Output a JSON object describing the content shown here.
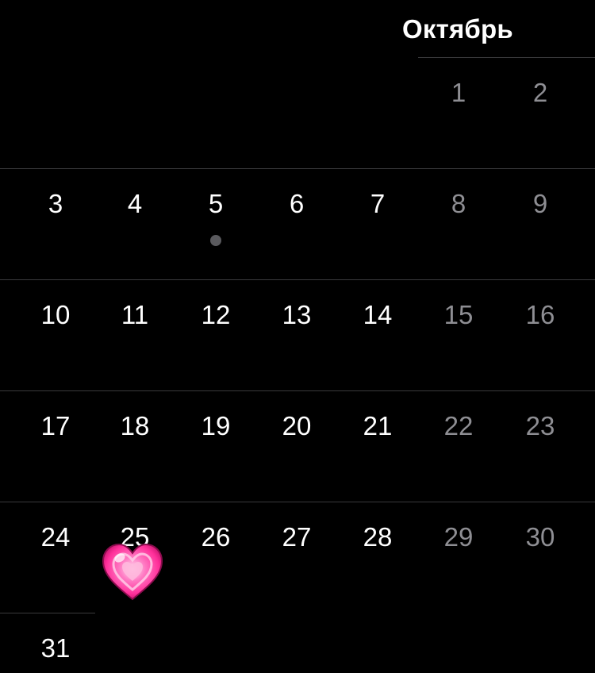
{
  "calendar": {
    "month_label": "Октябрь",
    "weeks": [
      [
        null,
        null,
        null,
        null,
        null,
        {
          "day": "1",
          "weekend": true
        },
        {
          "day": "2",
          "weekend": true
        }
      ],
      [
        {
          "day": "3"
        },
        {
          "day": "4"
        },
        {
          "day": "5",
          "has_event": true
        },
        {
          "day": "6"
        },
        {
          "day": "7"
        },
        {
          "day": "8",
          "weekend": true
        },
        {
          "day": "9",
          "weekend": true
        }
      ],
      [
        {
          "day": "10"
        },
        {
          "day": "11"
        },
        {
          "day": "12"
        },
        {
          "day": "13"
        },
        {
          "day": "14"
        },
        {
          "day": "15",
          "weekend": true
        },
        {
          "day": "16",
          "weekend": true
        }
      ],
      [
        {
          "day": "17"
        },
        {
          "day": "18"
        },
        {
          "day": "19"
        },
        {
          "day": "20"
        },
        {
          "day": "21"
        },
        {
          "day": "22",
          "weekend": true
        },
        {
          "day": "23",
          "weekend": true
        }
      ],
      [
        {
          "day": "24"
        },
        {
          "day": "25",
          "sticker": "heart-icon"
        },
        {
          "day": "26"
        },
        {
          "day": "27"
        },
        {
          "day": "28"
        },
        {
          "day": "29",
          "weekend": true
        },
        {
          "day": "30",
          "weekend": true
        }
      ],
      [
        {
          "day": "31"
        },
        null,
        null,
        null,
        null,
        null,
        null
      ]
    ]
  },
  "colors": {
    "background": "#000000",
    "weekday_text": "#ffffff",
    "weekend_text": "#8e8e93",
    "separator": "#3a3a3c",
    "event_dot": "#5a5a5e",
    "heart": "#ff3fa4"
  }
}
